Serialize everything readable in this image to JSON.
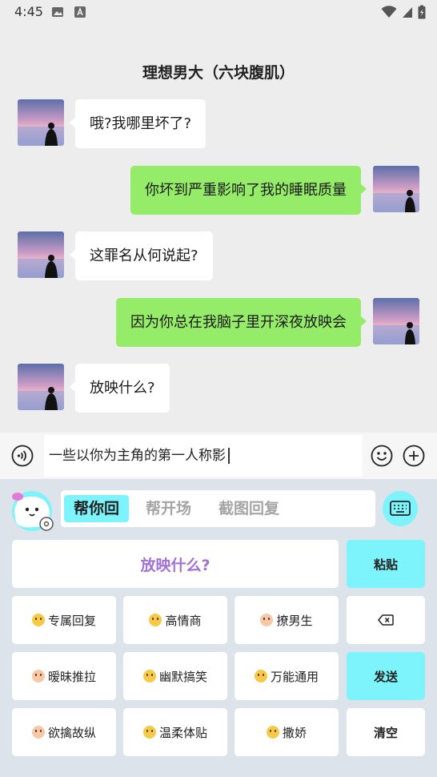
{
  "status_bar": {
    "time": "4:45"
  },
  "header": {
    "title": "理想男大（六块腹肌）"
  },
  "messages": [
    {
      "side": "in",
      "text": "哦?我哪里坏了?"
    },
    {
      "side": "out",
      "text": "你坏到严重影响了我的睡眠质量"
    },
    {
      "side": "in",
      "text": "这罪名从何说起?"
    },
    {
      "side": "out",
      "text": "因为你总在我脑子里开深夜放映会"
    },
    {
      "side": "in",
      "text": "放映什么?"
    }
  ],
  "input": {
    "value": "一些以你为主角的第一人称影"
  },
  "assistant": {
    "tabs": [
      "帮你回",
      "帮开场",
      "截图回复"
    ],
    "active_tab": 0,
    "suggestion": "放映什么?",
    "paste_label": "粘贴",
    "send_label": "发送",
    "clear_label": "清空",
    "styles": [
      {
        "label": "专属回复",
        "icon": "grin-emoji-icon"
      },
      {
        "label": "高情商",
        "icon": "star-struck-emoji-icon"
      },
      {
        "label": "撩男生",
        "icon": "woman-tipping-hand-icon"
      },
      {
        "label": "暧昧推拉",
        "icon": "kissing-couple-icon"
      },
      {
        "label": "幽默搞笑",
        "icon": "tongue-wink-emoji-icon"
      },
      {
        "label": "万能通用",
        "icon": "grin-squint-emoji-icon"
      },
      {
        "label": "欲擒故纵",
        "icon": "woman-shrugging-icon"
      },
      {
        "label": "温柔体贴",
        "icon": "smiling-blush-emoji-icon"
      },
      {
        "label": "撒娇",
        "icon": "smile-emoji-icon"
      }
    ]
  },
  "colors": {
    "outgoing_bubble": "#95ec69",
    "incoming_bubble": "#ffffff",
    "accent_cyan": "#7df4fb",
    "suggestion_text": "#a071d6",
    "background": "#ededed"
  }
}
